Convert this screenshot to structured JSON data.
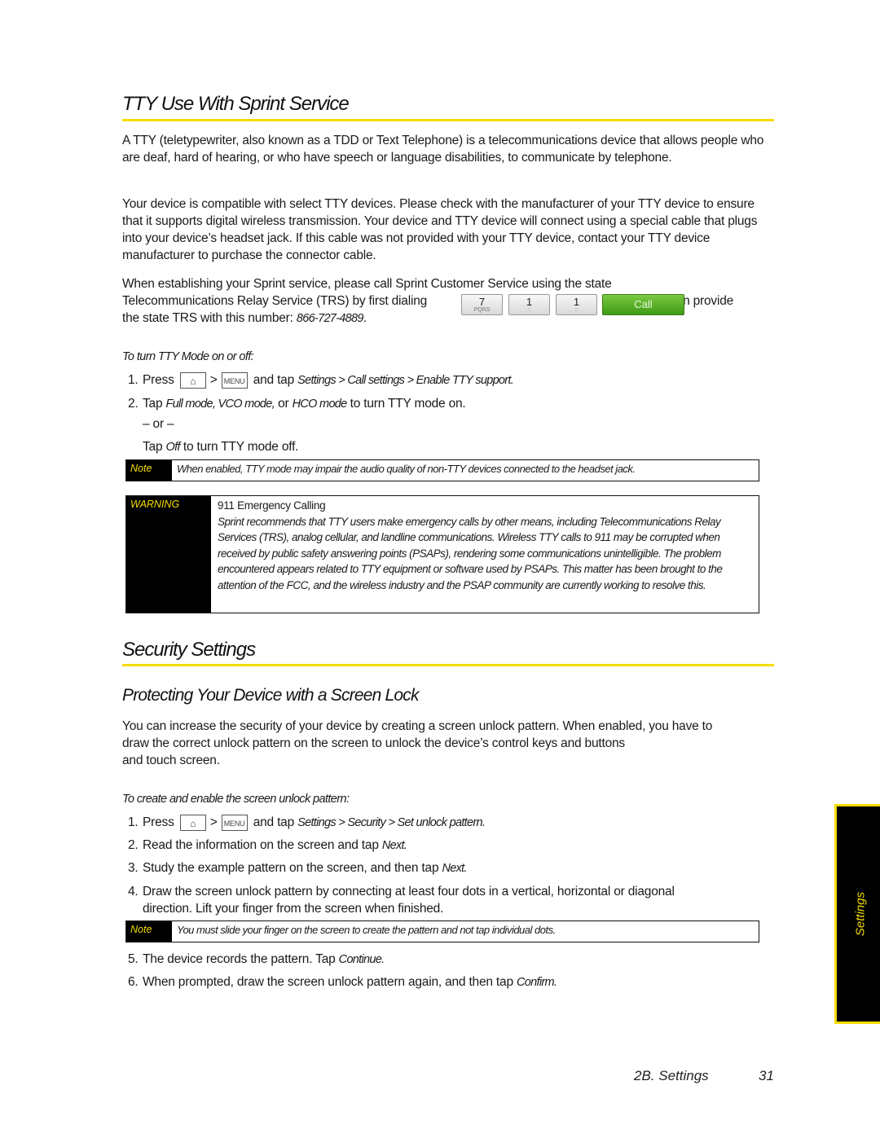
{
  "section1": {
    "title": "TTY Use With Sprint Service",
    "para1": "A TTY (teletypewriter, also known as a TDD or Text Telephone) is a telecommunications device that allows people who are deaf, hard of hearing, or who have speech or language disabilities, to communicate by telephone.",
    "para2": "Your device is compatible with select TTY devices. Please check with the manufacturer of your TTY device to ensure that it supports digital wireless transmission. Your device and TTY device will connect using a special cable that plugs into your device’s headset jack. If this cable was not provided with your TTY device, contact your TTY device manufacturer to purchase the connector cable.",
    "para3_line1": "When establishing your Sprint service, please call Sprint Customer Service using the state",
    "para3_line2_pre": "Telecommunications Relay Service (TRS) by first dialing",
    "para3_line2_post": ". Then provide",
    "para3_line3_pre": "the state TRS with this number: ",
    "trs_number": "866-727-4889",
    "para3_line3_post": ".",
    "dial_keys": [
      {
        "digit": "7",
        "sub": "PQRS"
      },
      {
        "digit": "1",
        "sub": "◌"
      },
      {
        "digit": "1",
        "sub": "◌"
      }
    ],
    "call_button": "Call",
    "procedure_title": "To turn TTY Mode on or off:",
    "steps": {
      "s1_num": "1.",
      "s1_pre": "Press",
      "home_key": "⌂",
      "gt": ">",
      "menu_key": "MENU",
      "s1_mid": "and tap",
      "s1_path": "Settings > Call settings > Enable TTY support.",
      "s2_num": "2.",
      "s2_pre": "Tap",
      "s2_opt1": "Full mode, VCO mode,",
      "s2_or": "or",
      "s2_opt2": "HCO mode",
      "s2_post": "to turn TTY mode on.",
      "or_line": "– or –",
      "off_pre": "Tap",
      "off_opt": "Off",
      "off_post": "to turn TTY mode off."
    },
    "note": {
      "label": "Note",
      "text": "When enabled, TTY mode may impair the audio quality of non-TTY devices connected to the headset jack."
    },
    "warning": {
      "label": "WARNING",
      "title": "911 Emergency Calling",
      "body": "Sprint recommends that TTY users make emergency calls by other means, including Telecommunications Relay Services (TRS), analog cellular, and landline communications. Wireless TTY calls to 911 may be corrupted when received by public safety answering points (PSAPs), rendering some communications unintelligible. The problem encountered appears related to TTY equipment or software used by PSAPs. This matter has been brought to the attention of the FCC, and the wireless industry and the PSAP community are currently working to resolve this."
    }
  },
  "section2": {
    "title": "Security Settings",
    "subtitle": "Protecting Your Device with a Screen Lock",
    "para_line1": "You can increase the security of your device by creating a screen unlock pattern. When enabled, you have to",
    "para_line2": "draw the correct unlock pattern on the screen to unlock the device’s control keys and buttons",
    "para_line3": "and touch screen.",
    "procedure_title": "To create and enable the screen unlock pattern:",
    "steps": {
      "s1_num": "1.",
      "s1_pre": "Press",
      "home_key": "⌂",
      "gt": ">",
      "menu_key": "MENU",
      "s1_mid": "and tap",
      "s1_path": "Settings > Security > Set unlock pattern.",
      "s2_num": "2.",
      "s2_text": "Read the information on the screen and tap",
      "s2_em": "Next.",
      "s3_num": "3.",
      "s3_text": "Study the example pattern on the screen, and then tap",
      "s3_em": "Next.",
      "s4_num": "4.",
      "s4_line1": "Draw the screen unlock pattern by connecting at least four dots in a vertical, horizontal or diagonal",
      "s4_line2": "direction. Lift your finger from the screen when finished.",
      "s5_num": "5.",
      "s5_text": "The device records the pattern. Tap",
      "s5_em": "Continue.",
      "s6_num": "6.",
      "s6_text": "When prompted, draw the screen unlock pattern again, and then tap",
      "s6_em": "Confirm."
    },
    "note": {
      "label": "Note",
      "text": "You must slide your finger on the screen to create the pattern and not tap individual dots."
    }
  },
  "side_tab": "Settings",
  "footer": {
    "section": "2B. Settings",
    "page": "31"
  },
  "colors": {
    "accent_yellow": "#f5dc00",
    "call_green": "#4ea61e"
  }
}
